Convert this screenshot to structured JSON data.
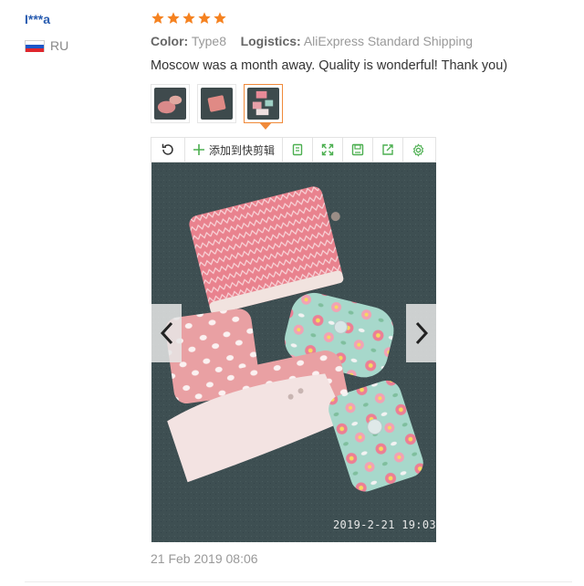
{
  "review": {
    "username": "I***a",
    "country_code": "RU",
    "rating": 5,
    "star_color": "#f58220",
    "color_label": "Color:",
    "color_value": "Type8",
    "logistics_label": "Logistics:",
    "logistics_value": "AliExpress Standard Shipping",
    "comment": "Moscow was a month away. Quality is wonderful! Thank you)",
    "date": "21 Feb 2019 08:06"
  },
  "gallery": {
    "thumbnails": [
      {
        "name": "photo-1",
        "active": false
      },
      {
        "name": "photo-2",
        "active": false
      },
      {
        "name": "photo-3",
        "active": true
      }
    ],
    "active_index": 2,
    "photo_timestamp": "2019-2-21 19:03"
  },
  "toolbar": {
    "add_label": "添加到快剪辑",
    "icons": [
      "rotate-icon",
      "plus-icon",
      "copy-icon",
      "expand-icon",
      "save-icon",
      "share-icon",
      "settings-icon"
    ],
    "icon_color": "#4caf50"
  }
}
